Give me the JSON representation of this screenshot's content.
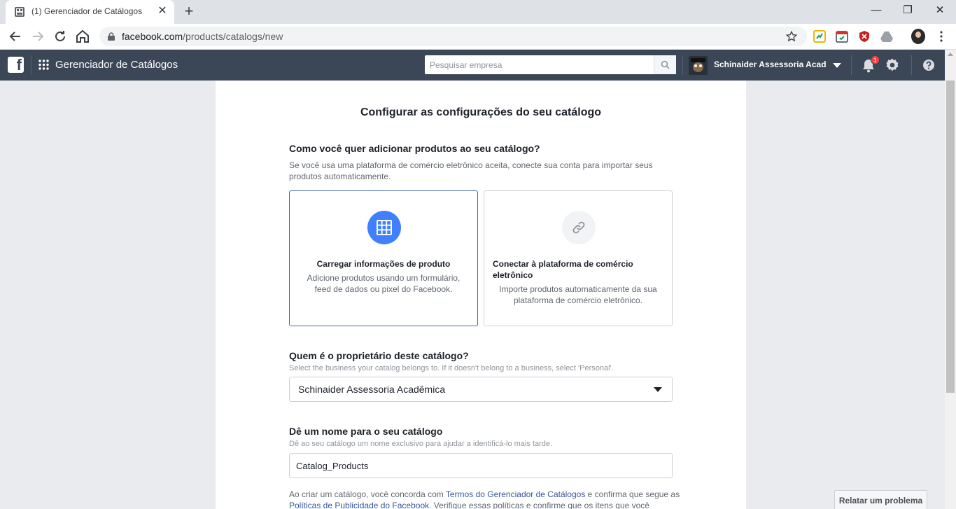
{
  "browser": {
    "tab_title": "(1) Gerenciador de Catálogos",
    "tab_close": "✕",
    "new_tab": "+",
    "url_host": "facebook.com",
    "url_path": "/products/catalogs/new",
    "window_controls": {
      "minimize": "—",
      "restore": "❐",
      "close": "✕"
    }
  },
  "header": {
    "app_title": "Gerenciador de Catálogos",
    "search_placeholder": "Pesquisar empresa",
    "business_name": "Schinaider Assessoria Acad...",
    "notification_count": "1"
  },
  "page": {
    "title": "Configurar as configurações do seu catálogo",
    "add_products": {
      "heading": "Como você quer adicionar produtos ao seu catálogo?",
      "description": "Se você usa uma plataforma de comércio eletrônico aceita, conecte sua conta para importar seus produtos automaticamente.",
      "options": [
        {
          "title": "Carregar informações de produto",
          "description": "Adicione produtos usando um formulário, feed de dados ou pixel do Facebook.",
          "selected": true,
          "icon": "grid-icon",
          "accent": "#4080ff"
        },
        {
          "title": "Conectar à plataforma de comércio eletrônico",
          "description": "Importe produtos automaticamente da sua plataforma de comércio eletrônico.",
          "selected": false,
          "icon": "link-icon"
        }
      ]
    },
    "owner": {
      "heading": "Quem é o proprietário deste catálogo?",
      "description": "Select the business your catalog belongs to. If it doesn't belong to a business, select 'Personal'.",
      "selected_value": "Schinaider Assessoria Acadêmica"
    },
    "catalog_name": {
      "heading": "Dê um nome para o seu catálogo",
      "description": "Dê ao seu catálogo um nome exclusivo para ajudar a identificá-lo mais tarde.",
      "value": "Catalog_Products"
    },
    "terms": {
      "prefix": "Ao criar um catálogo, você concorda com ",
      "link1": "Termos do Gerenciador de Catálogos",
      "middle": " e confirma que segue as ",
      "link2": "Políticas de Publicidade do Facebook",
      "suffix": ". Verifique essas políticas e confirme que os itens que você"
    }
  },
  "report_problem_label": "Relatar um problema",
  "colors": {
    "header_bg": "#3b4656",
    "selected_border": "#4267b2",
    "link": "#365899",
    "notification_badge": "#fa3e3e"
  }
}
